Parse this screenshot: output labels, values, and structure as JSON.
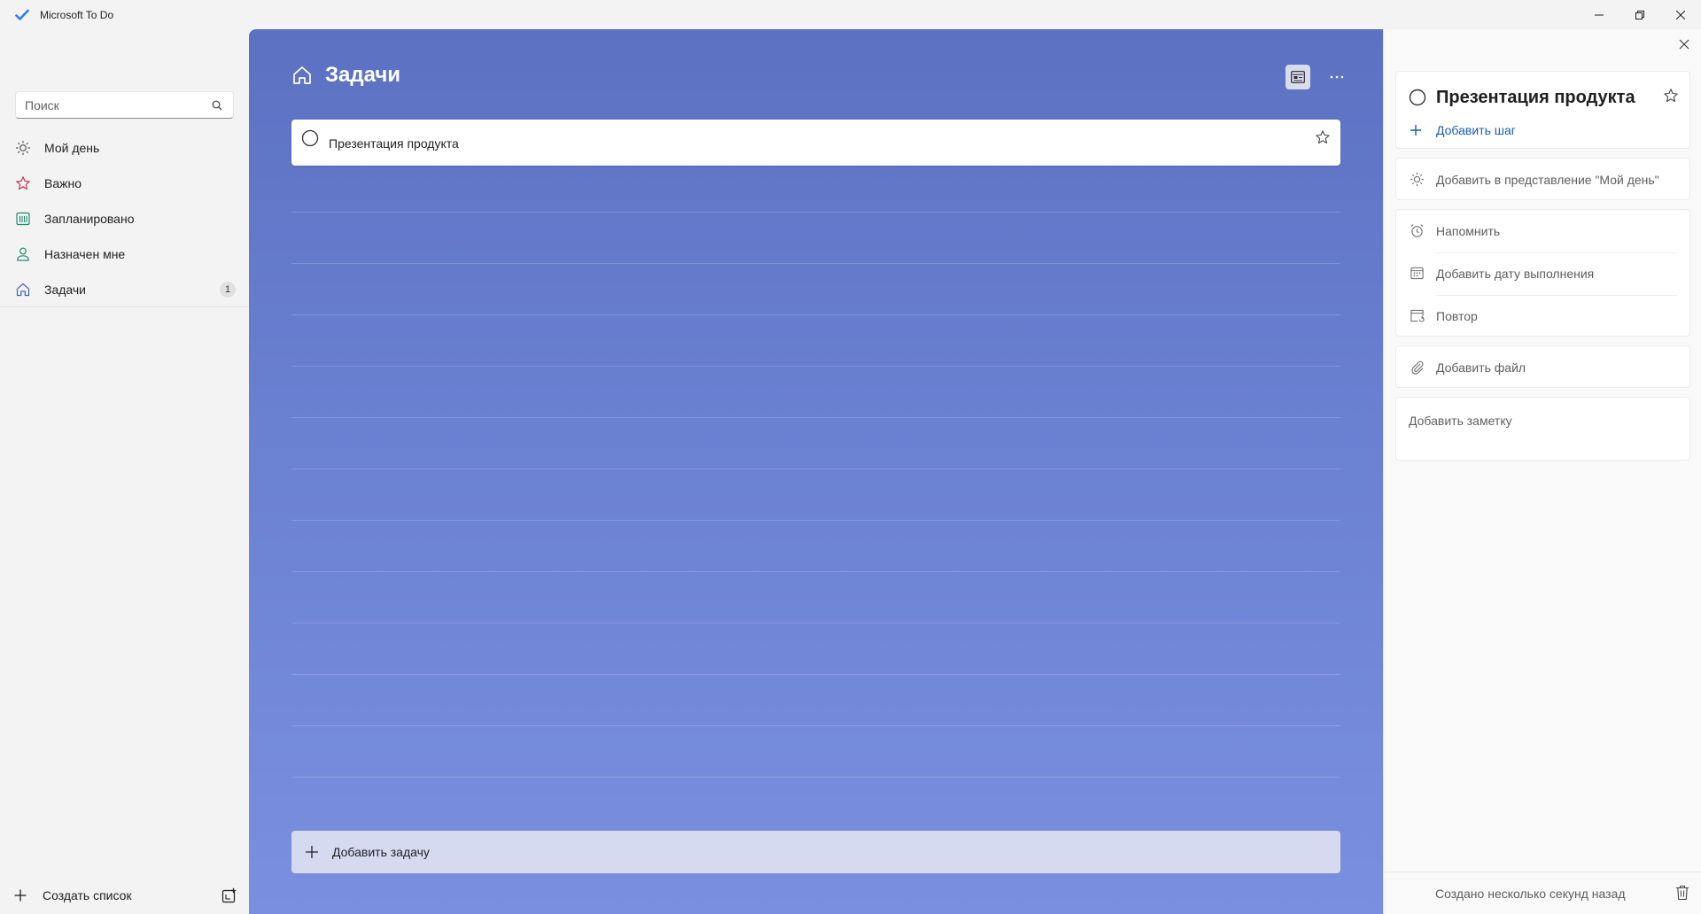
{
  "window": {
    "title": "Microsoft To Do",
    "accent": "#5c71c2"
  },
  "sidebar": {
    "search_placeholder": "Поиск",
    "items": [
      {
        "label": "Мой день",
        "icon": "sun-icon",
        "count": ""
      },
      {
        "label": "Важно",
        "icon": "star-icon",
        "count": ""
      },
      {
        "label": "Запланировано",
        "icon": "calendar-icon",
        "count": ""
      },
      {
        "label": "Назначен мне",
        "icon": "person-icon",
        "count": ""
      },
      {
        "label": "Задачи",
        "icon": "home-icon",
        "count": "1"
      }
    ],
    "create_list_label": "Создать список"
  },
  "main": {
    "title": "Задачи",
    "tasks": [
      {
        "title": "Презентация продукта",
        "completed": false,
        "important": false
      }
    ],
    "add_task_label": "Добавить задачу"
  },
  "details": {
    "task_title": "Презентация продукта",
    "add_step_label": "Добавить шаг",
    "add_to_my_day_label": "Добавить в представление \"Мой день\"",
    "remind_label": "Напомнить",
    "due_date_label": "Добавить дату выполнения",
    "repeat_label": "Повтор",
    "add_file_label": "Добавить файл",
    "note_placeholder": "Добавить заметку",
    "created_text": "Создано несколько секунд назад"
  }
}
